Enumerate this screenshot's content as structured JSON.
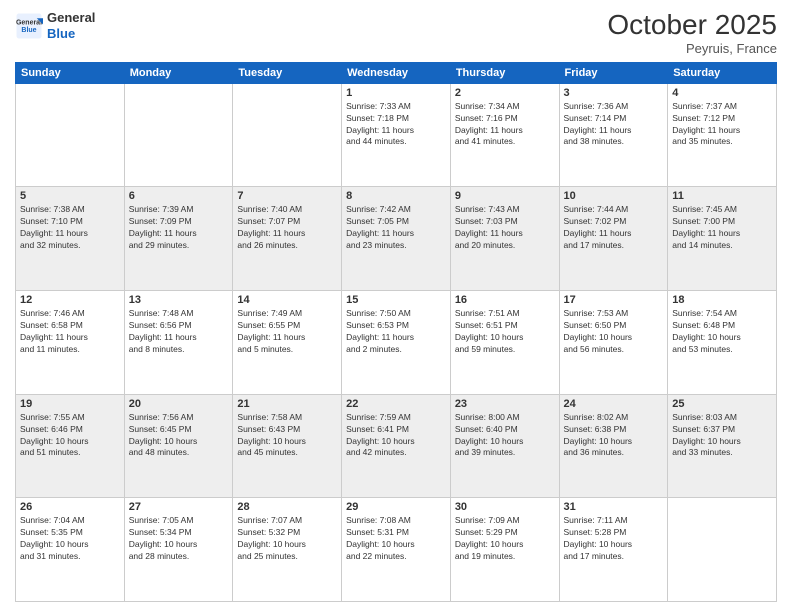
{
  "header": {
    "logo_line1": "General",
    "logo_line2": "Blue",
    "month_title": "October 2025",
    "location": "Peyruis, France"
  },
  "days_of_week": [
    "Sunday",
    "Monday",
    "Tuesday",
    "Wednesday",
    "Thursday",
    "Friday",
    "Saturday"
  ],
  "weeks": [
    [
      {
        "day": "",
        "content": ""
      },
      {
        "day": "",
        "content": ""
      },
      {
        "day": "",
        "content": ""
      },
      {
        "day": "1",
        "content": "Sunrise: 7:33 AM\nSunset: 7:18 PM\nDaylight: 11 hours\nand 44 minutes."
      },
      {
        "day": "2",
        "content": "Sunrise: 7:34 AM\nSunset: 7:16 PM\nDaylight: 11 hours\nand 41 minutes."
      },
      {
        "day": "3",
        "content": "Sunrise: 7:36 AM\nSunset: 7:14 PM\nDaylight: 11 hours\nand 38 minutes."
      },
      {
        "day": "4",
        "content": "Sunrise: 7:37 AM\nSunset: 7:12 PM\nDaylight: 11 hours\nand 35 minutes."
      }
    ],
    [
      {
        "day": "5",
        "content": "Sunrise: 7:38 AM\nSunset: 7:10 PM\nDaylight: 11 hours\nand 32 minutes."
      },
      {
        "day": "6",
        "content": "Sunrise: 7:39 AM\nSunset: 7:09 PM\nDaylight: 11 hours\nand 29 minutes."
      },
      {
        "day": "7",
        "content": "Sunrise: 7:40 AM\nSunset: 7:07 PM\nDaylight: 11 hours\nand 26 minutes."
      },
      {
        "day": "8",
        "content": "Sunrise: 7:42 AM\nSunset: 7:05 PM\nDaylight: 11 hours\nand 23 minutes."
      },
      {
        "day": "9",
        "content": "Sunrise: 7:43 AM\nSunset: 7:03 PM\nDaylight: 11 hours\nand 20 minutes."
      },
      {
        "day": "10",
        "content": "Sunrise: 7:44 AM\nSunset: 7:02 PM\nDaylight: 11 hours\nand 17 minutes."
      },
      {
        "day": "11",
        "content": "Sunrise: 7:45 AM\nSunset: 7:00 PM\nDaylight: 11 hours\nand 14 minutes."
      }
    ],
    [
      {
        "day": "12",
        "content": "Sunrise: 7:46 AM\nSunset: 6:58 PM\nDaylight: 11 hours\nand 11 minutes."
      },
      {
        "day": "13",
        "content": "Sunrise: 7:48 AM\nSunset: 6:56 PM\nDaylight: 11 hours\nand 8 minutes."
      },
      {
        "day": "14",
        "content": "Sunrise: 7:49 AM\nSunset: 6:55 PM\nDaylight: 11 hours\nand 5 minutes."
      },
      {
        "day": "15",
        "content": "Sunrise: 7:50 AM\nSunset: 6:53 PM\nDaylight: 11 hours\nand 2 minutes."
      },
      {
        "day": "16",
        "content": "Sunrise: 7:51 AM\nSunset: 6:51 PM\nDaylight: 10 hours\nand 59 minutes."
      },
      {
        "day": "17",
        "content": "Sunrise: 7:53 AM\nSunset: 6:50 PM\nDaylight: 10 hours\nand 56 minutes."
      },
      {
        "day": "18",
        "content": "Sunrise: 7:54 AM\nSunset: 6:48 PM\nDaylight: 10 hours\nand 53 minutes."
      }
    ],
    [
      {
        "day": "19",
        "content": "Sunrise: 7:55 AM\nSunset: 6:46 PM\nDaylight: 10 hours\nand 51 minutes."
      },
      {
        "day": "20",
        "content": "Sunrise: 7:56 AM\nSunset: 6:45 PM\nDaylight: 10 hours\nand 48 minutes."
      },
      {
        "day": "21",
        "content": "Sunrise: 7:58 AM\nSunset: 6:43 PM\nDaylight: 10 hours\nand 45 minutes."
      },
      {
        "day": "22",
        "content": "Sunrise: 7:59 AM\nSunset: 6:41 PM\nDaylight: 10 hours\nand 42 minutes."
      },
      {
        "day": "23",
        "content": "Sunrise: 8:00 AM\nSunset: 6:40 PM\nDaylight: 10 hours\nand 39 minutes."
      },
      {
        "day": "24",
        "content": "Sunrise: 8:02 AM\nSunset: 6:38 PM\nDaylight: 10 hours\nand 36 minutes."
      },
      {
        "day": "25",
        "content": "Sunrise: 8:03 AM\nSunset: 6:37 PM\nDaylight: 10 hours\nand 33 minutes."
      }
    ],
    [
      {
        "day": "26",
        "content": "Sunrise: 7:04 AM\nSunset: 5:35 PM\nDaylight: 10 hours\nand 31 minutes."
      },
      {
        "day": "27",
        "content": "Sunrise: 7:05 AM\nSunset: 5:34 PM\nDaylight: 10 hours\nand 28 minutes."
      },
      {
        "day": "28",
        "content": "Sunrise: 7:07 AM\nSunset: 5:32 PM\nDaylight: 10 hours\nand 25 minutes."
      },
      {
        "day": "29",
        "content": "Sunrise: 7:08 AM\nSunset: 5:31 PM\nDaylight: 10 hours\nand 22 minutes."
      },
      {
        "day": "30",
        "content": "Sunrise: 7:09 AM\nSunset: 5:29 PM\nDaylight: 10 hours\nand 19 minutes."
      },
      {
        "day": "31",
        "content": "Sunrise: 7:11 AM\nSunset: 5:28 PM\nDaylight: 10 hours\nand 17 minutes."
      },
      {
        "day": "",
        "content": ""
      }
    ]
  ]
}
